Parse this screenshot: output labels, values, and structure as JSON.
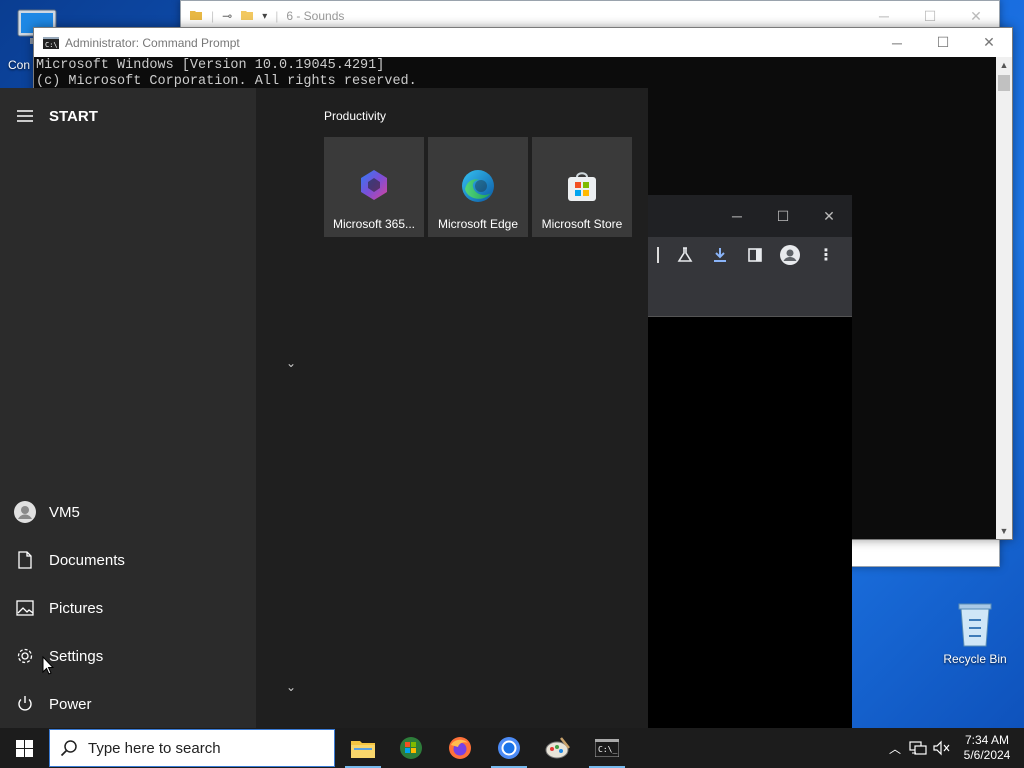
{
  "desktop": {
    "icons": [
      {
        "label": "Con"
      },
      {
        "label": "Recycle Bin"
      }
    ]
  },
  "explorer": {
    "title": "6 - Sounds"
  },
  "cmd": {
    "title": "Administrator: Command Prompt",
    "lines": [
      "Microsoft Windows [Version 10.0.19045.4291]",
      "(c) Microsoft Corporation. All rights reserved."
    ]
  },
  "start_menu": {
    "header": "START",
    "group_title": "Productivity",
    "tiles": [
      {
        "label": "Microsoft 365...",
        "icon": "microsoft-365-icon"
      },
      {
        "label": "Microsoft Edge",
        "icon": "edge-icon"
      },
      {
        "label": "Microsoft Store",
        "icon": "store-icon"
      }
    ],
    "nav": [
      {
        "label": "VM5",
        "icon": "user-icon"
      },
      {
        "label": "Documents",
        "icon": "document-icon"
      },
      {
        "label": "Pictures",
        "icon": "pictures-icon"
      },
      {
        "label": "Settings",
        "icon": "gear-icon"
      },
      {
        "label": "Power",
        "icon": "power-icon"
      }
    ]
  },
  "taskbar": {
    "search_placeholder": "Type here to search",
    "apps": [
      "file-explorer-icon",
      "windows7-ball-icon",
      "firefox-icon",
      "chrome-icon",
      "paint-icon",
      "cmd-icon"
    ],
    "time": "7:34 AM",
    "date": "5/6/2024"
  },
  "colors": {
    "accent": "#76b9ed",
    "start_left": "#2b2b2b",
    "start_right": "#1f1f1f"
  }
}
